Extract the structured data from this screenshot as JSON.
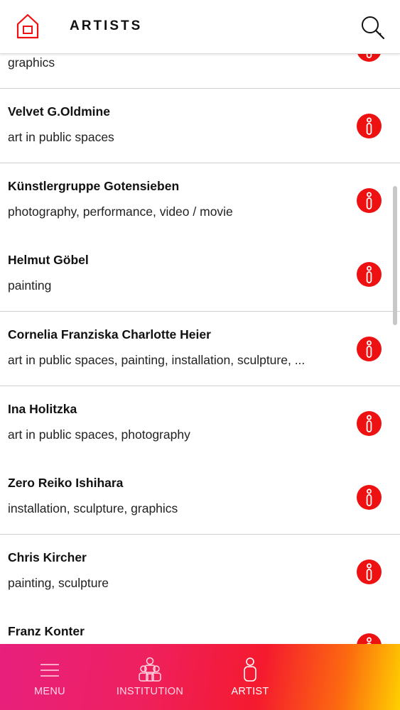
{
  "header": {
    "title": "ARTISTS",
    "home_icon": "home-icon",
    "search_icon": "search-icon"
  },
  "artists": [
    {
      "name": "",
      "categories": "graphics"
    },
    {
      "name": "Velvet G.Oldmine",
      "categories": "art in public spaces"
    },
    {
      "name": "Künstlergruppe Gotensieben",
      "categories": "photography, performance, video / movie"
    },
    {
      "name": "Helmut Göbel",
      "categories": "painting"
    },
    {
      "name": "Cornelia Franziska Charlotte Heier",
      "categories": "art in public spaces, painting, installation, sculpture, ..."
    },
    {
      "name": "Ina Holitzka",
      "categories": "art in public spaces, photography"
    },
    {
      "name": "Zero Reiko Ishihara",
      "categories": "installation, sculpture, graphics"
    },
    {
      "name": "Chris Kircher",
      "categories": "painting, sculpture"
    },
    {
      "name": "Franz Konter",
      "categories": ""
    }
  ],
  "nav": {
    "menu_label": "MENU",
    "institution_label": "INSTITUTION",
    "artist_label": "ARTIST",
    "active": "ARTIST"
  },
  "colors": {
    "accent_red": "#ee1111",
    "nav_gradient_start": "#e8207e",
    "nav_gradient_end": "#ffd000"
  }
}
